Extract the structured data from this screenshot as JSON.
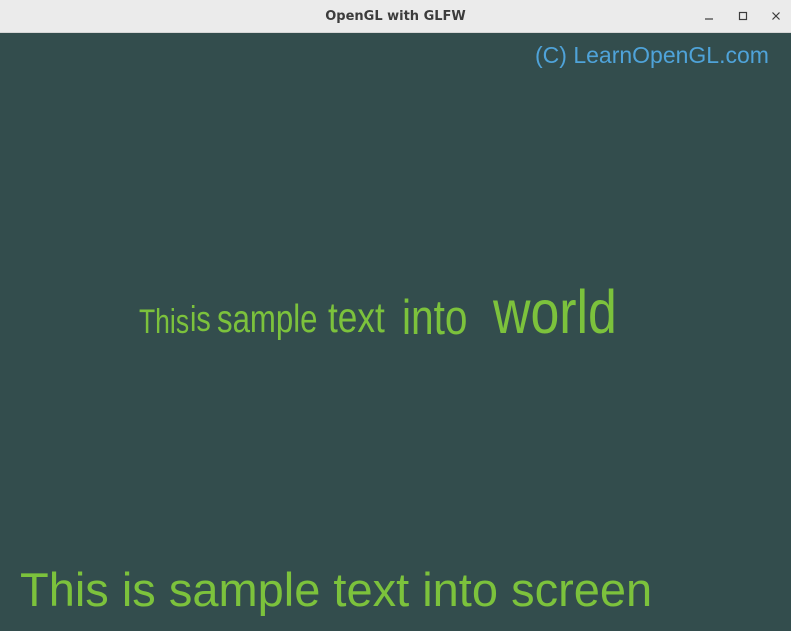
{
  "window": {
    "title": "OpenGL with GLFW",
    "controls": {
      "minimize_icon": "minimize-icon",
      "maximize_icon": "maximize-icon",
      "close_icon": "close-icon"
    }
  },
  "scene": {
    "background_color": "#334d4d",
    "copyright": "(C) LearnOpenGL.com",
    "copyright_color": "#4fa3d9",
    "world_text_words": [
      "This",
      "is",
      "sample",
      "text",
      "into",
      "world"
    ],
    "world_text_color": "#7cc23c",
    "screen_text": "This is sample text into screen",
    "screen_text_color": "#7cc23c"
  }
}
